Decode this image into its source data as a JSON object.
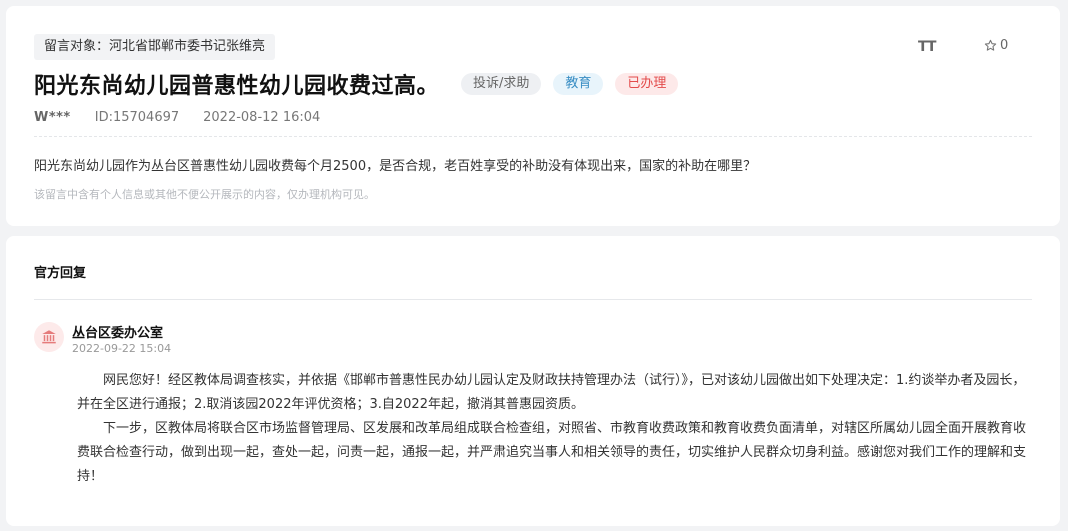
{
  "message": {
    "recipient": "留言对象：河北省邯郸市委书记张维亮",
    "font_size_label": "TT",
    "star_count": "0",
    "title": "阳光东尚幼儿园普惠性幼儿园收费过高。",
    "tags": {
      "type": "投诉/求助",
      "category": "教育",
      "status": "已办理"
    },
    "author": "W***",
    "id": "ID:15704697",
    "datetime": "2022-08-12 16:04",
    "content": "阳光东尚幼儿园作为丛台区普惠性幼儿园收费每个月2500，是否合规，老百姓享受的补助没有体现出来，国家的补助在哪里？",
    "privacy_note": "该留言中含有个人信息或其他不便公开展示的内容，仅办理机构可见。"
  },
  "reply": {
    "heading": "官方回复",
    "office": "丛台区委办公室",
    "date": "2022-09-22 15:04",
    "paragraphs": [
      "网民您好！经区教体局调查核实，并依据《邯郸市普惠性民办幼儿园认定及财政扶持管理办法（试行）》，已对该幼儿园做出如下处理决定：1.约谈举办者及园长，并在全区进行通报；2.取消该园2022年评优资格；3.自2022年起，撤消其普惠园资质。",
      "下一步，区教体局将联合区市场监督管理局、区发展和改革局组成联合检查组，对照省、市教育收费政策和教育收费负面清单，对辖区所属幼儿园全面开展教育收费联合检查行动，做到出现一起，查处一起，问责一起，通报一起，并严肃追究当事人和相关领导的责任，切实维护人民群众切身利益。感谢您对我们工作的理解和支持！"
    ]
  },
  "icons": {
    "font": "font-size-icon",
    "star": "star-icon",
    "avatar": "government-building-icon"
  },
  "colors": {
    "status_red": "#e34b4b",
    "category_blue": "#3a8ec4"
  }
}
